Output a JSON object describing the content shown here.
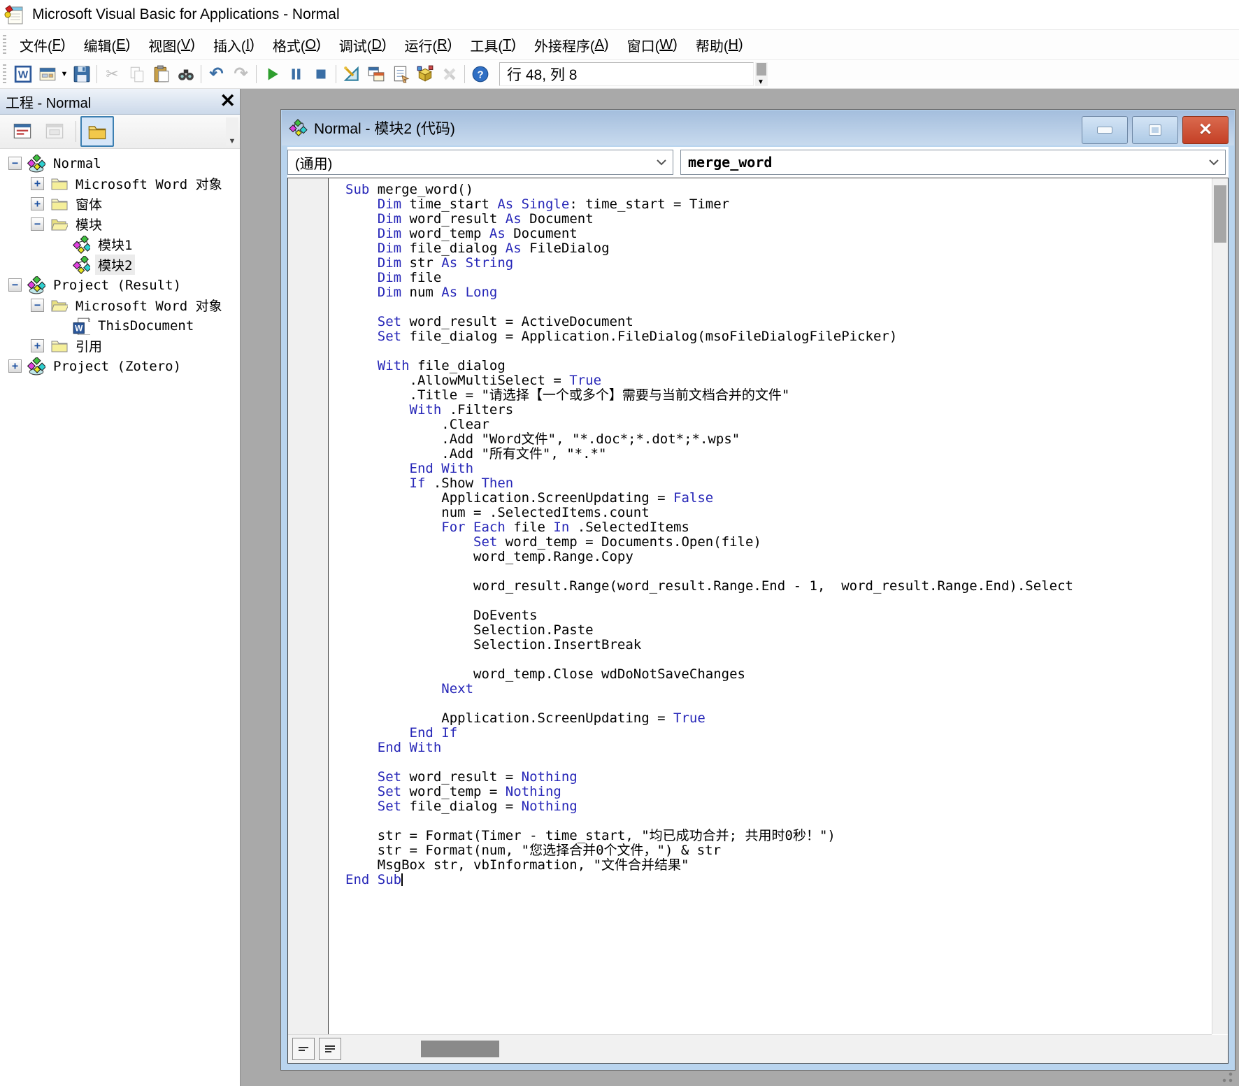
{
  "window": {
    "title": "Microsoft Visual Basic for Applications - Normal"
  },
  "menu": {
    "items": [
      {
        "pre": "文件(",
        "mn": "F",
        "post": ")"
      },
      {
        "pre": "编辑(",
        "mn": "E",
        "post": ")"
      },
      {
        "pre": "视图(",
        "mn": "V",
        "post": ")"
      },
      {
        "pre": "插入(",
        "mn": "I",
        "post": ")"
      },
      {
        "pre": "格式(",
        "mn": "O",
        "post": ")"
      },
      {
        "pre": "调试(",
        "mn": "D",
        "post": ")"
      },
      {
        "pre": "运行(",
        "mn": "R",
        "post": ")"
      },
      {
        "pre": "工具(",
        "mn": "T",
        "post": ")"
      },
      {
        "pre": "外接程序(",
        "mn": "A",
        "post": ")"
      },
      {
        "pre": "窗口(",
        "mn": "W",
        "post": ")"
      },
      {
        "pre": "帮助(",
        "mn": "H",
        "post": ")"
      }
    ]
  },
  "toolbar": {
    "status": "行 48, 列 8",
    "items": [
      {
        "name": "view-word-icon"
      },
      {
        "name": "insert-userform-icon",
        "dropdown": true
      },
      {
        "name": "save-icon"
      },
      {
        "sep": true
      },
      {
        "name": "cut-icon",
        "disabled": true
      },
      {
        "name": "copy-icon",
        "disabled": true
      },
      {
        "name": "paste-icon"
      },
      {
        "name": "find-icon"
      },
      {
        "sep": true
      },
      {
        "name": "undo-icon"
      },
      {
        "name": "redo-icon",
        "disabled": true
      },
      {
        "sep": true
      },
      {
        "name": "run-icon"
      },
      {
        "name": "break-icon"
      },
      {
        "name": "reset-icon"
      },
      {
        "sep": true
      },
      {
        "name": "design-mode-icon"
      },
      {
        "name": "project-explorer-icon"
      },
      {
        "name": "properties-window-icon"
      },
      {
        "name": "object-browser-icon"
      },
      {
        "name": "toolbox-icon",
        "disabled": true
      },
      {
        "sep": true
      },
      {
        "name": "help-icon"
      }
    ]
  },
  "project_panel": {
    "title": "工程 - Normal",
    "toolbar": [
      {
        "name": "view-code-icon",
        "selected": false,
        "disabled": false
      },
      {
        "name": "view-object-icon",
        "selected": false,
        "disabled": true
      },
      {
        "name": "toggle-folders-icon",
        "selected": true,
        "disabled": false
      }
    ],
    "tree": [
      {
        "level": 0,
        "expand": "minus",
        "icon": "project",
        "label": "Normal"
      },
      {
        "level": 1,
        "expand": "plus",
        "icon": "folder",
        "label": "Microsoft Word 对象"
      },
      {
        "level": 1,
        "expand": "plus",
        "icon": "folder",
        "label": "窗体"
      },
      {
        "level": 1,
        "expand": "minus",
        "icon": "folder-open",
        "label": "模块"
      },
      {
        "level": 2,
        "expand": "none",
        "icon": "module",
        "label": "模块1"
      },
      {
        "level": 2,
        "expand": "none",
        "icon": "module",
        "label": "模块2",
        "selected": true
      },
      {
        "level": 0,
        "expand": "minus",
        "icon": "project",
        "label": "Project (Result)"
      },
      {
        "level": 1,
        "expand": "minus",
        "icon": "folder-open",
        "label": "Microsoft Word 对象"
      },
      {
        "level": 2,
        "expand": "none",
        "icon": "worddoc",
        "label": "ThisDocument"
      },
      {
        "level": 1,
        "expand": "plus",
        "icon": "folder",
        "label": "引用"
      },
      {
        "level": 0,
        "expand": "plus",
        "icon": "project",
        "label": "Project (Zotero)"
      }
    ]
  },
  "code_window": {
    "title": "Normal - 模块2 (代码)",
    "left_combo": "(通用)",
    "right_combo": "merge_word",
    "caret_line": 48,
    "colors": {
      "keyword": "#2727b8",
      "text": "#000000"
    },
    "code_lines": [
      {
        "seg": [
          [
            "k",
            "Sub "
          ],
          [
            "t",
            "merge_word()"
          ]
        ]
      },
      {
        "seg": [
          [
            "k",
            "    Dim "
          ],
          [
            "t",
            "time_start "
          ],
          [
            "k",
            "As Single"
          ],
          [
            "t",
            ": time_start = Timer"
          ]
        ]
      },
      {
        "seg": [
          [
            "k",
            "    Dim "
          ],
          [
            "t",
            "word_result "
          ],
          [
            "k",
            "As "
          ],
          [
            "t",
            "Document"
          ]
        ]
      },
      {
        "seg": [
          [
            "k",
            "    Dim "
          ],
          [
            "t",
            "word_temp "
          ],
          [
            "k",
            "As "
          ],
          [
            "t",
            "Document"
          ]
        ]
      },
      {
        "seg": [
          [
            "k",
            "    Dim "
          ],
          [
            "t",
            "file_dialog "
          ],
          [
            "k",
            "As "
          ],
          [
            "t",
            "FileDialog"
          ]
        ]
      },
      {
        "seg": [
          [
            "k",
            "    Dim "
          ],
          [
            "t",
            "str "
          ],
          [
            "k",
            "As String"
          ]
        ]
      },
      {
        "seg": [
          [
            "k",
            "    Dim "
          ],
          [
            "t",
            "file"
          ]
        ]
      },
      {
        "seg": [
          [
            "k",
            "    Dim "
          ],
          [
            "t",
            "num "
          ],
          [
            "k",
            "As Long"
          ]
        ]
      },
      {
        "seg": []
      },
      {
        "seg": [
          [
            "k",
            "    Set "
          ],
          [
            "t",
            "word_result = ActiveDocument"
          ]
        ]
      },
      {
        "seg": [
          [
            "k",
            "    Set "
          ],
          [
            "t",
            "file_dialog = Application.FileDialog(msoFileDialogFilePicker)"
          ]
        ]
      },
      {
        "seg": []
      },
      {
        "seg": [
          [
            "k",
            "    With "
          ],
          [
            "t",
            "file_dialog"
          ]
        ]
      },
      {
        "seg": [
          [
            "t",
            "        .AllowMultiSelect = "
          ],
          [
            "k",
            "True"
          ]
        ]
      },
      {
        "seg": [
          [
            "t",
            "        .Title = \"请选择【一个或多个】需要与当前文档合并的文件\""
          ]
        ]
      },
      {
        "seg": [
          [
            "k",
            "        With "
          ],
          [
            "t",
            ".Filters"
          ]
        ]
      },
      {
        "seg": [
          [
            "t",
            "            .Clear"
          ]
        ]
      },
      {
        "seg": [
          [
            "t",
            "            .Add \"Word文件\", \"*.doc*;*.dot*;*.wps\""
          ]
        ]
      },
      {
        "seg": [
          [
            "t",
            "            .Add \"所有文件\", \"*.*\""
          ]
        ]
      },
      {
        "seg": [
          [
            "k",
            "        End With"
          ]
        ]
      },
      {
        "seg": [
          [
            "k",
            "        If "
          ],
          [
            "t",
            ".Show "
          ],
          [
            "k",
            "Then"
          ]
        ]
      },
      {
        "seg": [
          [
            "t",
            "            Application.ScreenUpdating = "
          ],
          [
            "k",
            "False"
          ]
        ]
      },
      {
        "seg": [
          [
            "t",
            "            num = .SelectedItems.count"
          ]
        ]
      },
      {
        "seg": [
          [
            "k",
            "            For Each "
          ],
          [
            "t",
            "file "
          ],
          [
            "k",
            "In "
          ],
          [
            "t",
            ".SelectedItems"
          ]
        ]
      },
      {
        "seg": [
          [
            "k",
            "                Set "
          ],
          [
            "t",
            "word_temp = Documents.Open(file)"
          ]
        ]
      },
      {
        "seg": [
          [
            "t",
            "                word_temp.Range.Copy"
          ]
        ]
      },
      {
        "seg": []
      },
      {
        "seg": [
          [
            "t",
            "                word_result.Range(word_result.Range.End - 1,  word_result.Range.End).Select"
          ]
        ]
      },
      {
        "seg": []
      },
      {
        "seg": [
          [
            "t",
            "                DoEvents"
          ]
        ]
      },
      {
        "seg": [
          [
            "t",
            "                Selection.Paste"
          ]
        ]
      },
      {
        "seg": [
          [
            "t",
            "                Selection.InsertBreak"
          ]
        ]
      },
      {
        "seg": []
      },
      {
        "seg": [
          [
            "t",
            "                word_temp.Close wdDoNotSaveChanges"
          ]
        ]
      },
      {
        "seg": [
          [
            "k",
            "            Next"
          ]
        ]
      },
      {
        "seg": []
      },
      {
        "seg": [
          [
            "t",
            "            Application.ScreenUpdating = "
          ],
          [
            "k",
            "True"
          ]
        ]
      },
      {
        "seg": [
          [
            "k",
            "        End If"
          ]
        ]
      },
      {
        "seg": [
          [
            "k",
            "    End With"
          ]
        ]
      },
      {
        "seg": []
      },
      {
        "seg": [
          [
            "k",
            "    Set "
          ],
          [
            "t",
            "word_result = "
          ],
          [
            "k",
            "Nothing"
          ]
        ]
      },
      {
        "seg": [
          [
            "k",
            "    Set "
          ],
          [
            "t",
            "word_temp = "
          ],
          [
            "k",
            "Nothing"
          ]
        ]
      },
      {
        "seg": [
          [
            "k",
            "    Set "
          ],
          [
            "t",
            "file_dialog = "
          ],
          [
            "k",
            "Nothing"
          ]
        ]
      },
      {
        "seg": []
      },
      {
        "seg": [
          [
            "t",
            "    str = Format(Timer - time_start, \"均已成功合并; 共用时0秒！\")"
          ]
        ]
      },
      {
        "seg": [
          [
            "t",
            "    str = Format(num, \"您选择合并0个文件，\") & str"
          ]
        ]
      },
      {
        "seg": [
          [
            "t",
            "    MsgBox str, vbInformation, \"文件合并结果\""
          ]
        ]
      },
      {
        "seg": [
          [
            "k",
            "End Sub"
          ]
        ],
        "caret": true
      }
    ]
  },
  "colors": {
    "mdi_background": "#a9a9a9",
    "keyword_blue": "#2727b8",
    "window_frame": "#b9d4ee",
    "title_gradient_top": "#a4bedd",
    "title_gradient_bottom": "#c8daee",
    "close_button_red": "#c44026",
    "panel_header_top": "#eef3f9",
    "panel_header_bottom": "#ccd9ea",
    "tree_selection": "#ebebeb"
  }
}
